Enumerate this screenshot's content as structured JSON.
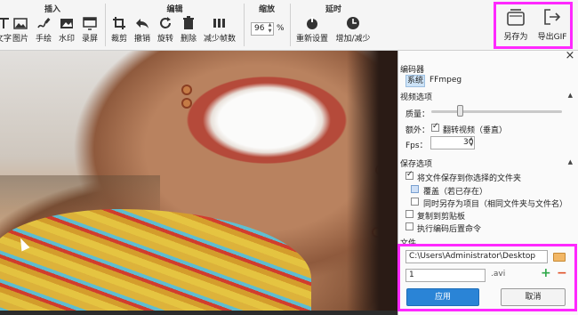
{
  "toolbar": {
    "groups": {
      "insert": "插入",
      "edit": "编辑",
      "zoom": "缩放",
      "delay": "延时"
    },
    "insert_buttons": [
      {
        "label": "文字",
        "icon": "text-icon"
      },
      {
        "label": "图片",
        "icon": "image-icon"
      },
      {
        "label": "手绘",
        "icon": "freehand-icon"
      },
      {
        "label": "水印",
        "icon": "watermark-icon"
      },
      {
        "label": "录屏",
        "icon": "record-screen-icon"
      }
    ],
    "edit_buttons": [
      {
        "label": "裁剪",
        "icon": "crop-icon"
      },
      {
        "label": "撤销",
        "icon": "undo-icon"
      },
      {
        "label": "旋转",
        "icon": "rotate-icon"
      },
      {
        "label": "删除",
        "icon": "delete-icon"
      },
      {
        "label": "减少帧数",
        "icon": "reduce-frames-icon"
      }
    ],
    "zoom": {
      "value": "96",
      "unit": "%"
    },
    "delay_buttons": [
      {
        "label": "重新设置",
        "icon": "reset-icon"
      },
      {
        "label": "增加/减少",
        "icon": "clock-icon"
      }
    ],
    "export_buttons": [
      {
        "label": "另存为",
        "icon": "save-as-icon"
      },
      {
        "label": "导出GIF",
        "icon": "export-gif-icon"
      }
    ]
  },
  "panel": {
    "encoder_section": "编码器",
    "encoder_options": [
      "系统",
      "FFmpeg"
    ],
    "video_section": "视频选项",
    "quality_label": "质量：",
    "quality_level": 0.22,
    "extra_label": "额外：",
    "flip_label": "翻转视频（垂直）",
    "fps_label": "Fps：",
    "fps_value": "30",
    "save_section": "保存选项",
    "save_to_folder": "将文件保存到你选择的文件夹",
    "overwrite": "覆盖（若已存在）",
    "save_as_project": "同时另存为项目（相同文件夹与文件名）",
    "copy_clipboard": "复制到剪贴板",
    "run_command": "执行编码后置命令",
    "file_section": "文件",
    "path_value": "C:\\Users\\Administrator\\Desktop",
    "filename_value": "1",
    "ext_value": ".avi",
    "apply": "应用",
    "cancel": "取消"
  },
  "colors": {
    "highlight": "#ff28ff",
    "apply_blue": "#2a84d6",
    "panel_bg": "#fafafa"
  }
}
